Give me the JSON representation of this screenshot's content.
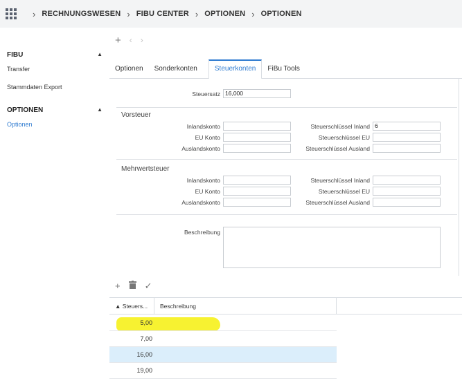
{
  "breadcrumb": [
    "RECHNUNGSWESEN",
    "FIBU CENTER",
    "OPTIONEN",
    "OPTIONEN"
  ],
  "sidebar": {
    "groups": [
      {
        "label": "FIBU",
        "items": [
          "Transfer",
          "Stammdaten Export"
        ]
      },
      {
        "label": "OPTIONEN",
        "items": [
          "Optionen"
        ]
      }
    ]
  },
  "toolbar": {
    "add": "+",
    "prev": "‹",
    "next": "›"
  },
  "tabs": [
    "Optionen",
    "Sonderkonten",
    "Steuerkonten",
    "FiBu Tools"
  ],
  "active_tab": "Steuerkonten",
  "form": {
    "steuersatz_label": "Steuersatz",
    "steuersatz_value": "16,000",
    "vorsteuer": {
      "title": "Vorsteuer",
      "inlandskonto_label": "Inlandskonto",
      "inlandskonto_value": "",
      "eu_konto_label": "EU Konto",
      "eu_konto_value": "",
      "auslandskonto_label": "Auslandskonto",
      "auslandskonto_value": "",
      "sk_inland_label": "Steuerschlüssel Inland",
      "sk_inland_value": "6",
      "sk_eu_label": "Steuerschlüssel EU",
      "sk_eu_value": "",
      "sk_ausland_label": "Steuerschlüssel Ausland",
      "sk_ausland_value": ""
    },
    "mehrwertsteuer": {
      "title": "Mehrwertsteuer",
      "inlandskonto_label": "Inlandskonto",
      "inlandskonto_value": "",
      "eu_konto_label": "EU Konto",
      "eu_konto_value": "",
      "auslandskonto_label": "Auslandskonto",
      "auslandskonto_value": "",
      "sk_inland_label": "Steuerschlüssel Inland",
      "sk_inland_value": "",
      "sk_eu_label": "Steuerschlüssel EU",
      "sk_eu_value": "",
      "sk_ausland_label": "Steuerschlüssel Ausland",
      "sk_ausland_value": ""
    },
    "beschreibung_label": "Beschreibung"
  },
  "grid": {
    "columns": [
      "▲ Steuers...",
      "Beschreibung"
    ],
    "rows": [
      "5,00",
      "7,00",
      "16,00",
      "19,00"
    ],
    "selected_row": "16,00"
  },
  "colors": {
    "accent": "#2f7bd0",
    "highlight": "#f7f231",
    "selected": "#dbeefb"
  }
}
